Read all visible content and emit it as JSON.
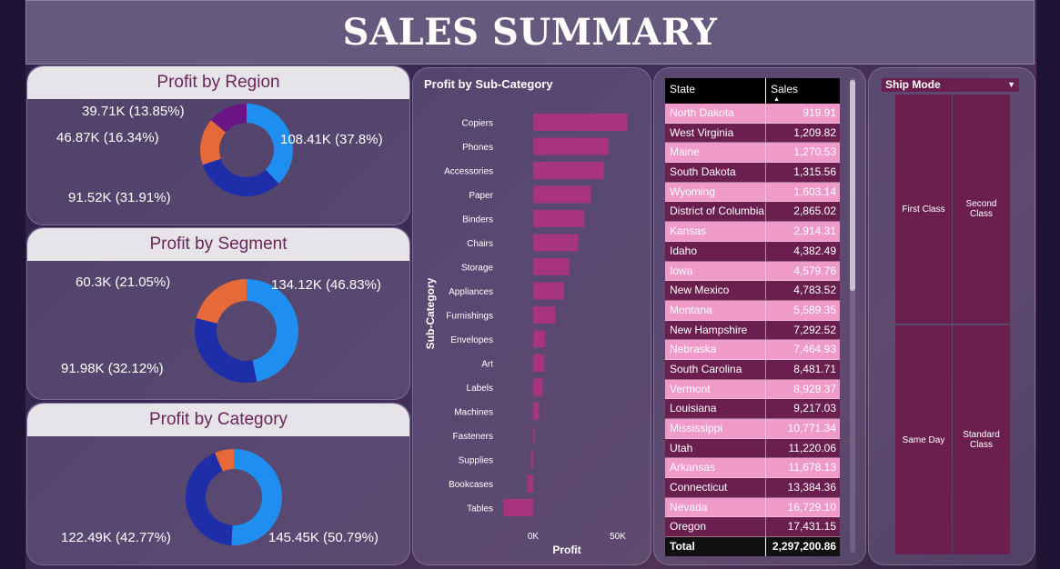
{
  "header": {
    "title": "SALES SUMMARY"
  },
  "chart_data": [
    {
      "type": "pie",
      "title": "Profit by Region",
      "slices": [
        {
          "value": 108.41,
          "label": "108.41K (37.8%)",
          "percent": 37.8,
          "color": "#1f8ef1"
        },
        {
          "value": 91.52,
          "label": "91.52K (31.91%)",
          "percent": 31.91,
          "color": "#1e2ea8"
        },
        {
          "value": 46.87,
          "label": "46.87K (16.34%)",
          "percent": 16.34,
          "color": "#e6693a"
        },
        {
          "value": 39.71,
          "label": "39.71K (13.85%)",
          "percent": 13.85,
          "color": "#6b1584"
        }
      ]
    },
    {
      "type": "pie",
      "title": "Profit by Segment",
      "slices": [
        {
          "value": 134.12,
          "label": "134.12K (46.83%)",
          "percent": 46.83,
          "color": "#1f8ef1"
        },
        {
          "value": 91.98,
          "label": "91.98K (32.12%)",
          "percent": 32.12,
          "color": "#1e2ea8"
        },
        {
          "value": 60.3,
          "label": "60.3K (21.05%)",
          "percent": 21.05,
          "color": "#e6693a"
        }
      ]
    },
    {
      "type": "pie",
      "title": "Profit by Category",
      "slices": [
        {
          "value": 145.45,
          "label": "145.45K (50.79%)",
          "percent": 50.79,
          "color": "#1f8ef1"
        },
        {
          "value": 122.49,
          "label": "122.49K (42.77%)",
          "percent": 42.77,
          "color": "#1e2ea8"
        },
        {
          "value": 18.45,
          "label": "",
          "percent": 6.44,
          "color": "#e6693a"
        }
      ]
    },
    {
      "type": "bar",
      "orientation": "horizontal",
      "title": "Profit by Sub-Category",
      "xlabel": "Profit",
      "ylabel": "Sub-Category",
      "xticks": [
        "0K",
        "50K"
      ],
      "xlim": [
        -18,
        58
      ],
      "bar_color": "#a8337e",
      "categories": [
        "Copiers",
        "Phones",
        "Accessories",
        "Paper",
        "Binders",
        "Chairs",
        "Storage",
        "Appliances",
        "Furnishings",
        "Envelopes",
        "Art",
        "Labels",
        "Machines",
        "Fasteners",
        "Supplies",
        "Bookcases",
        "Tables"
      ],
      "values": [
        55.6,
        44.5,
        41.9,
        34.1,
        30.2,
        26.6,
        21.3,
        18.1,
        13.1,
        6.96,
        6.53,
        5.55,
        3.38,
        0.95,
        -1.19,
        -3.47,
        -17.7
      ]
    }
  ],
  "sales_table": {
    "headers": [
      "State",
      "Sales"
    ],
    "rows": [
      [
        "North Dakota",
        "919.91"
      ],
      [
        "West Virginia",
        "1,209.82"
      ],
      [
        "Maine",
        "1,270.53"
      ],
      [
        "South Dakota",
        "1,315.56"
      ],
      [
        "Wyoming",
        "1,603.14"
      ],
      [
        "District of Columbia",
        "2,865.02"
      ],
      [
        "Kansas",
        "2,914.31"
      ],
      [
        "Idaho",
        "4,382.49"
      ],
      [
        "Iowa",
        "4,579.76"
      ],
      [
        "New Mexico",
        "4,783.52"
      ],
      [
        "Montana",
        "5,589.35"
      ],
      [
        "New Hampshire",
        "7,292.52"
      ],
      [
        "Nebraska",
        "7,464.93"
      ],
      [
        "South Carolina",
        "8,481.71"
      ],
      [
        "Vermont",
        "8,929.37"
      ],
      [
        "Louisiana",
        "9,217.03"
      ],
      [
        "Mississippi",
        "10,771.34"
      ],
      [
        "Utah",
        "11,220.06"
      ],
      [
        "Arkansas",
        "11,678.13"
      ],
      [
        "Connecticut",
        "13,384.36"
      ],
      [
        "Nevada",
        "16,729.10"
      ],
      [
        "Oregon",
        "17,431.15"
      ]
    ],
    "total_label": "Total",
    "total_value": "2,297,200.86"
  },
  "ship_mode": {
    "title": "Ship Mode",
    "tiles": [
      "First Class",
      "Second Class",
      "Same Day",
      "Standard Class"
    ],
    "tile_color": "#6b1f4f"
  }
}
